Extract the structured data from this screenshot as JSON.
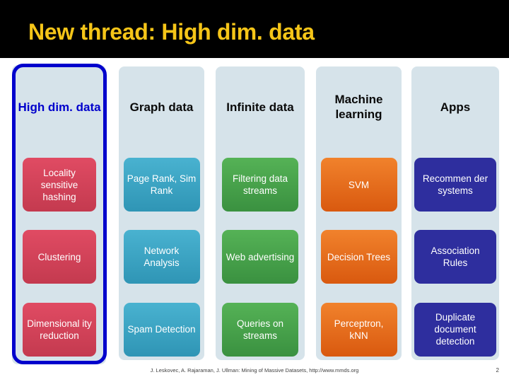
{
  "slide": {
    "title": "New thread: High dim. data",
    "title_color": "#F5C518",
    "title_bar_color": "#000000"
  },
  "matrix": {
    "highlight_color": "#0000CC",
    "column_bg_color": "#D6E3EA",
    "columns": [
      {
        "header": "High dim. data",
        "highlighted": true,
        "color": "#C43A4F",
        "swatch": "c-pink",
        "cells": [
          "Locality sensitive hashing",
          "Clustering",
          "Dimensional ity reduction"
        ]
      },
      {
        "header": "Graph data",
        "highlighted": false,
        "color": "#2F95B5",
        "swatch": "c-teal",
        "cells": [
          "Page Rank, Sim Rank",
          "Network Analysis",
          "Spam Detection"
        ]
      },
      {
        "header": "Infinite data",
        "highlighted": false,
        "color": "#3A9140",
        "swatch": "c-green",
        "cells": [
          "Filtering data streams",
          "Web advertising",
          "Queries on streams"
        ]
      },
      {
        "header": "Machine learning",
        "highlighted": false,
        "color": "#D9590F",
        "swatch": "c-orange",
        "cells": [
          "SVM",
          "Decision Trees",
          "Perceptron, kNN"
        ]
      },
      {
        "header": "Apps",
        "highlighted": false,
        "color": "#2E2E9E",
        "swatch": "c-navy",
        "cells": [
          "Recommen der systems",
          "Association Rules",
          "Duplicate document detection"
        ]
      }
    ]
  },
  "footer": {
    "citation": "J. Leskovec, A. Rajaraman, J. Ullman: Mining of Massive Datasets, http://www.mmds.org",
    "page_number": "2"
  }
}
